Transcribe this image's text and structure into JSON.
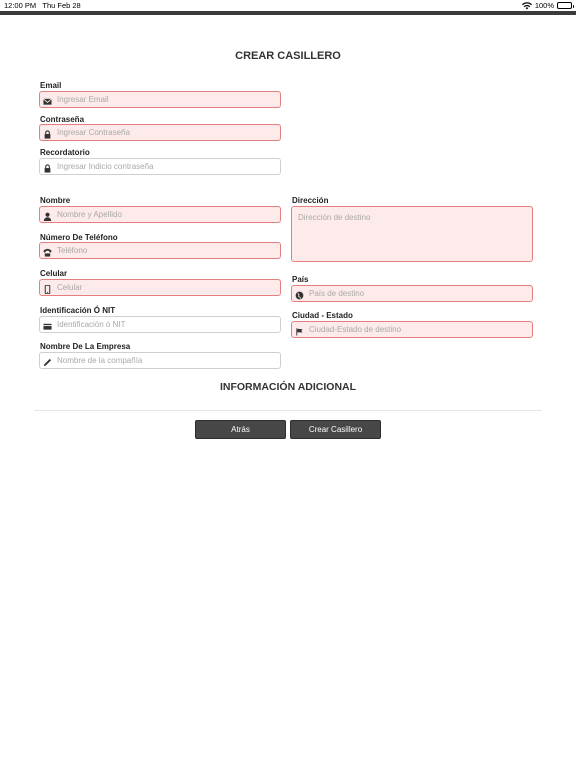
{
  "status_bar": {
    "time": "12:00 PM",
    "date": "Thu Feb 28",
    "battery": "100%"
  },
  "title": "CREAR CASILLERO",
  "fields": {
    "email": {
      "label": "Email",
      "placeholder": "Ingresar Email",
      "icon": "envelope-icon",
      "error": true
    },
    "password": {
      "label": "Contraseña",
      "placeholder": "Ingresar Contraseña",
      "icon": "lock-icon",
      "error": true
    },
    "reminder": {
      "label": "Recordatorio",
      "placeholder": "Ingresar Indicio contraseña",
      "icon": "lock-icon",
      "error": false
    },
    "name": {
      "label": "Nombre",
      "placeholder": "Nombre y Apellido",
      "icon": "user-icon",
      "error": true
    },
    "phone": {
      "label": "Número De Teléfono",
      "placeholder": "Teléfono",
      "icon": "phone-icon",
      "error": true
    },
    "mobile": {
      "label": "Celular",
      "placeholder": "Celular",
      "icon": "mobile-icon",
      "error": true
    },
    "nit": {
      "label": "Identificación Ó NIT",
      "placeholder": "Identificación ó NIT",
      "icon": "id-card-icon",
      "error": false
    },
    "company": {
      "label": "Nombre De La Empresa",
      "placeholder": "Nombre de la compañía",
      "icon": "pencil-icon",
      "error": false
    },
    "address": {
      "label": "Dirección",
      "placeholder": "Dirección de destino",
      "error": true
    },
    "country": {
      "label": "País",
      "placeholder": "País de destino",
      "icon": "globe-icon",
      "error": true
    },
    "city": {
      "label": "Ciudad - Estado",
      "placeholder": "Ciudad-Estado de destino",
      "icon": "flag-icon",
      "error": true
    }
  },
  "additional_info_title": "INFORMACIÓN ADICIONAL",
  "buttons": {
    "back": "Atrás",
    "create": "Crear Casillero"
  },
  "colors": {
    "error_border": "#e57f7f",
    "error_fill": "#fdeaea",
    "button": "#474747"
  }
}
